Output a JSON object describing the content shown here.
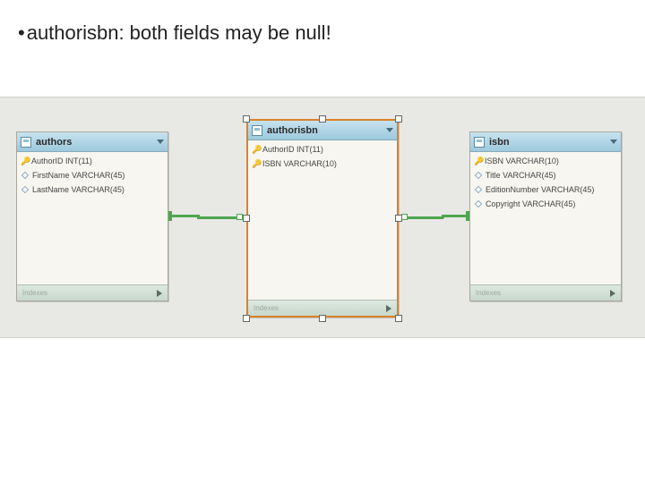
{
  "caption": {
    "bullet": "•",
    "text": "authorisbn:  both fields may be null!"
  },
  "tables": {
    "authors": {
      "title": "authors",
      "columns": [
        {
          "name": "AuthorID INT(11)",
          "pk": true
        },
        {
          "name": "FirstName VARCHAR(45)",
          "pk": false
        },
        {
          "name": "LastName VARCHAR(45)",
          "pk": false
        }
      ],
      "footer": "Indexes"
    },
    "authorisbn": {
      "title": "authorisbn",
      "columns": [
        {
          "name": "AuthorID INT(11)",
          "pk": true
        },
        {
          "name": "ISBN VARCHAR(10)",
          "pk": true
        }
      ],
      "footer": "Indexes",
      "selected": true
    },
    "isbn": {
      "title": "isbn",
      "columns": [
        {
          "name": "ISBN VARCHAR(10)",
          "pk": true
        },
        {
          "name": "Title VARCHAR(45)",
          "pk": false
        },
        {
          "name": "EditionNumber VARCHAR(45)",
          "pk": false
        },
        {
          "name": "Copyright VARCHAR(45)",
          "pk": false
        }
      ],
      "footer": "Indexes"
    }
  },
  "relations": [
    {
      "from": "authors",
      "to": "authorisbn",
      "type": "one-to-many"
    },
    {
      "from": "isbn",
      "to": "authorisbn",
      "type": "one-to-many"
    }
  ]
}
